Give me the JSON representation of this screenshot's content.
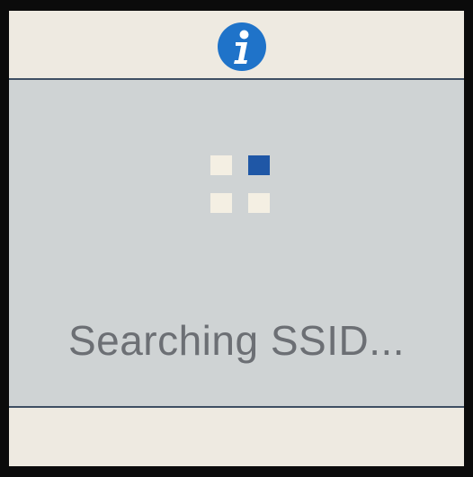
{
  "header": {
    "icon": "info-icon",
    "icon_glyph": "i",
    "icon_color": "#1f73c9"
  },
  "main": {
    "spinner": {
      "icon": "loading-grid-icon",
      "active_index": 1,
      "active_color": "#1f57a6",
      "inactive_color": "#f4efe3"
    },
    "status_text": "Searching SSID..."
  },
  "colors": {
    "panel_background": "#cfd3d4",
    "bar_background": "#eeeae1",
    "divider": "#3f4f63",
    "text": "#6c6f74"
  }
}
